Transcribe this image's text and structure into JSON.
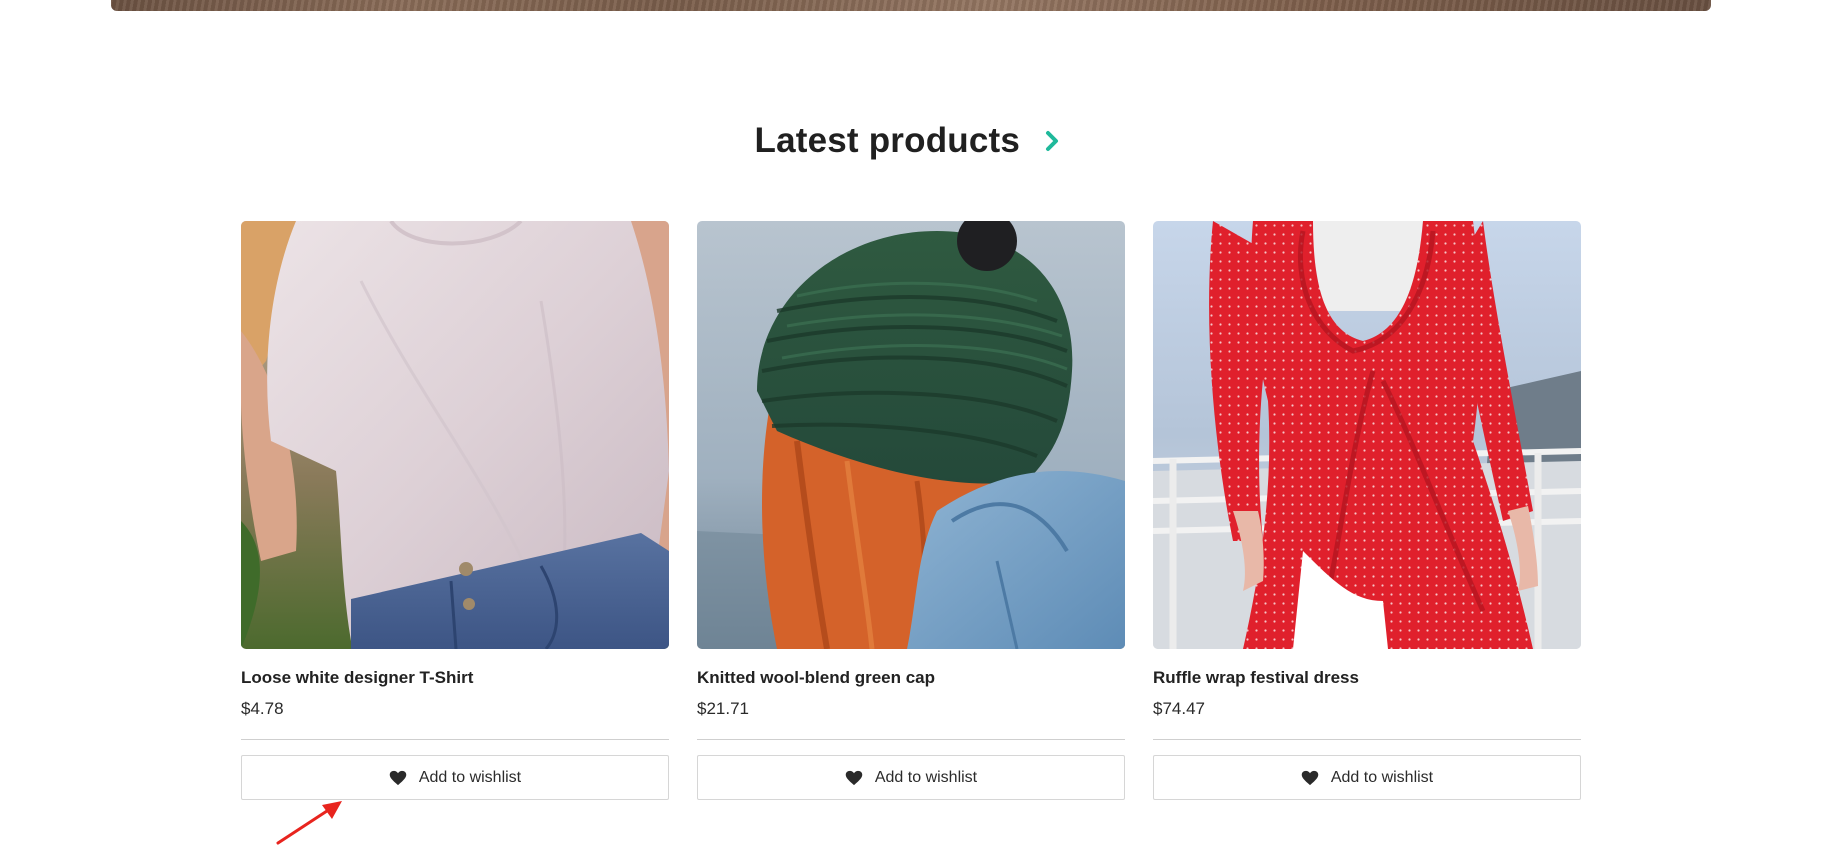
{
  "section": {
    "title": "Latest products",
    "title_arrow_icon": "chevron-right-icon",
    "accent_color": "#1fb99b"
  },
  "products": [
    {
      "name": "Loose white designer T-Shirt",
      "price": "$4.78",
      "image_alt": "Person wearing a loose white t-shirt and blue jeans",
      "wishlist_label": "Add to wishlist",
      "wishlist_icon": "heart-icon"
    },
    {
      "name": "Knitted wool-blend green cap",
      "price": "$21.71",
      "image_alt": "Red-haired person wearing a knitted green cap and denim jacket",
      "wishlist_label": "Add to wishlist",
      "wishlist_icon": "heart-icon"
    },
    {
      "name": "Ruffle wrap festival dress",
      "price": "$74.47",
      "image_alt": "Person wearing a red polka-dot ruffle wrap dress",
      "wishlist_label": "Add to wishlist",
      "wishlist_icon": "heart-icon"
    }
  ],
  "annotation": {
    "arrow_color": "#e8241e"
  }
}
